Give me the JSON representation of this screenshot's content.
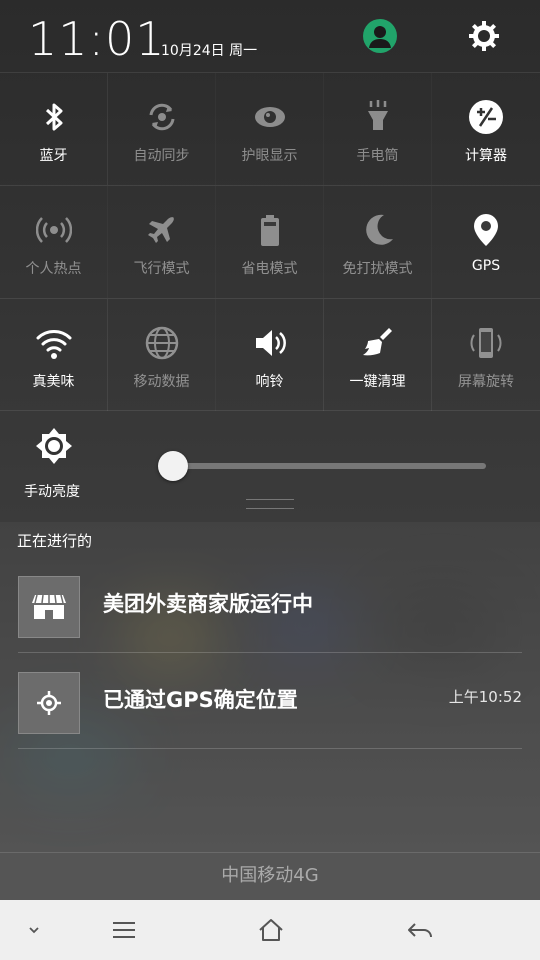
{
  "status_bar": {
    "time": "11:01",
    "date": "10月24日 周一",
    "user_icon": "user-avatar-icon",
    "settings_icon": "gear-icon"
  },
  "quick_toggles": [
    [
      {
        "label": "蓝牙",
        "icon": "bluetooth-icon",
        "active": true
      },
      {
        "label": "自动同步",
        "icon": "sync-icon",
        "active": false
      },
      {
        "label": "护眼显示",
        "icon": "eye-icon",
        "active": false
      },
      {
        "label": "手电筒",
        "icon": "flashlight-icon",
        "active": false
      },
      {
        "label": "计算器",
        "icon": "calculator-icon",
        "active": true
      }
    ],
    [
      {
        "label": "个人热点",
        "icon": "hotspot-icon",
        "active": false
      },
      {
        "label": "飞行模式",
        "icon": "airplane-icon",
        "active": false
      },
      {
        "label": "省电模式",
        "icon": "battery-icon",
        "active": false
      },
      {
        "label": "免打扰模式",
        "icon": "moon-icon",
        "active": false
      },
      {
        "label": "GPS",
        "icon": "location-icon",
        "active": true
      }
    ],
    [
      {
        "label": "真美味",
        "icon": "wifi-icon",
        "active": true
      },
      {
        "label": "移动数据",
        "icon": "globe-icon",
        "active": false
      },
      {
        "label": "响铃",
        "icon": "volume-icon",
        "active": true
      },
      {
        "label": "一键清理",
        "icon": "broom-icon",
        "active": true
      },
      {
        "label": "屏幕旋转",
        "icon": "rotate-phone-icon",
        "active": false
      }
    ]
  ],
  "brightness": {
    "label": "手动亮度",
    "icon": "brightness-icon",
    "level": 0.0
  },
  "notifications": {
    "section_title": "正在进行的",
    "items": [
      {
        "icon": "store-icon",
        "title": "美团外卖商家版运行中",
        "time": ""
      },
      {
        "icon": "gps-target-icon",
        "title": "已通过GPS确定位置",
        "time": "上午10:52"
      }
    ]
  },
  "carrier": "中国移动4G",
  "nav_icons": [
    "chevron-down-icon",
    "menu-icon",
    "home-icon",
    "back-icon"
  ],
  "colors": {
    "avatar_green": "#21a46a",
    "panel": "#3a3a3a",
    "navbar": "#efefef"
  }
}
